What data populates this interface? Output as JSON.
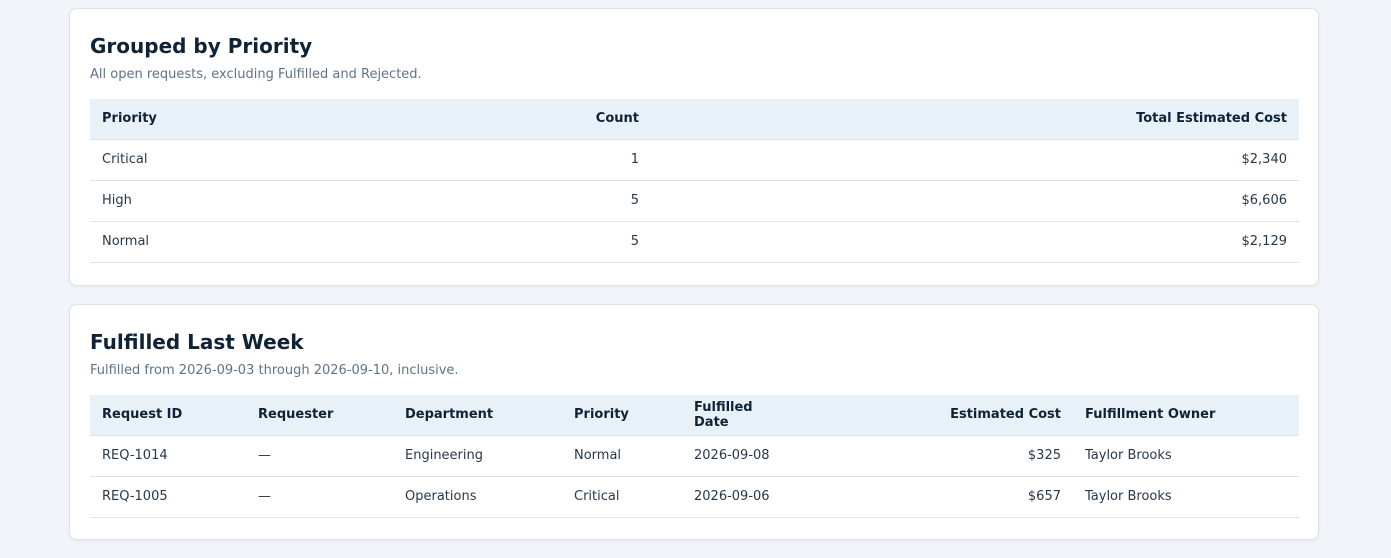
{
  "priority_section": {
    "title": "Grouped by Priority",
    "subtitle": "All open requests, excluding Fulfilled and Rejected.",
    "columns": [
      "Priority",
      "Count",
      "Total Estimated Cost"
    ],
    "rows": [
      [
        "Critical",
        "1",
        "$2,340"
      ],
      [
        "High",
        "5",
        "$6,606"
      ],
      [
        "Normal",
        "5",
        "$2,129"
      ]
    ]
  },
  "fulfilled_section": {
    "title": "Fulfilled Last Week",
    "subtitle": "Fulfilled from 2026-09-03 through 2026-09-10, inclusive.",
    "columns": [
      "Request ID",
      "Requester",
      "Department",
      "Priority",
      "Fulfilled Date",
      "Estimated Cost",
      "Fulfillment Owner"
    ],
    "rows": [
      [
        "REQ-1014",
        "—",
        "Engineering",
        "Normal",
        "2026-09-08",
        "$325",
        "Taylor Brooks"
      ],
      [
        "REQ-1005",
        "—",
        "Operations",
        "Critical",
        "2026-09-06",
        "$657",
        "Taylor Brooks"
      ]
    ]
  },
  "colors": {
    "page_background": "#f1f4f8",
    "card_background": "#ffffff",
    "table_header_background": "#e8f0f8",
    "heading_text": "#0f2236",
    "subtitle_text": "#5f7389"
  }
}
